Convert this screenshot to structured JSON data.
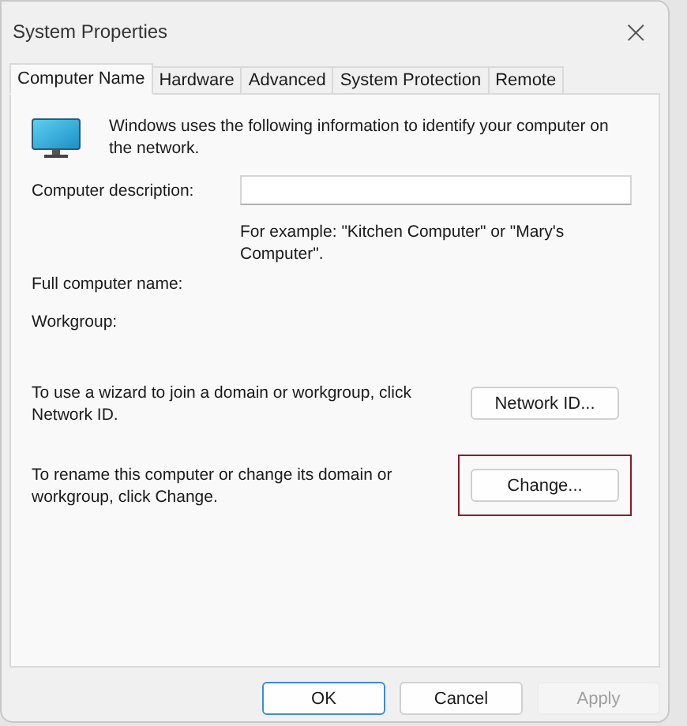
{
  "window": {
    "title": "System Properties",
    "close": "×"
  },
  "tabs": [
    {
      "label": "Computer Name",
      "selected": true
    },
    {
      "label": "Hardware",
      "selected": false
    },
    {
      "label": "Advanced",
      "selected": false
    },
    {
      "label": "System Protection",
      "selected": false
    },
    {
      "label": "Remote",
      "selected": false
    }
  ],
  "intro": "Windows uses the following information to identify your computer on the network.",
  "description": {
    "label": "Computer description:",
    "hint": "For example: \"Kitchen Computer\" or \"Mary's Computer\"."
  },
  "info_rows": [
    {
      "label": "Full computer name:"
    },
    {
      "label": "Workgroup:"
    }
  ],
  "actions": [
    {
      "text": "To use a wizard to join a domain or workgroup, click Network ID.",
      "button": "Network ID...",
      "highlighted": false
    },
    {
      "text": "To rename this computer or change its domain or workgroup, click Change.",
      "button": "Change...",
      "highlighted": true
    }
  ],
  "footer_buttons": [
    {
      "label": "OK",
      "default": true,
      "disabled": false
    },
    {
      "label": "Cancel",
      "default": false,
      "disabled": false
    },
    {
      "label": "Apply",
      "default": false,
      "disabled": true
    }
  ]
}
